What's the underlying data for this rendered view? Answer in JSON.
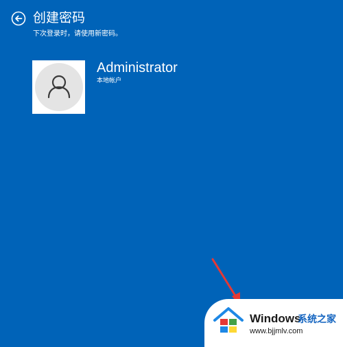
{
  "header": {
    "title": "创建密码",
    "subtitle": "下次登录时，请使用新密码。"
  },
  "user": {
    "name": "Administrator",
    "account_type": "本地帐户"
  },
  "watermark": {
    "brand": "Windows",
    "site_name": "系统之家",
    "url": "www.bjjmlv.com"
  },
  "icons": {
    "back": "back-arrow-circle-icon",
    "avatar": "user-avatar-icon",
    "logo": "windows-house-logo-icon"
  },
  "colors": {
    "background": "#0063b8",
    "text": "#ffffff",
    "annotation_arrow": "#e53935"
  }
}
